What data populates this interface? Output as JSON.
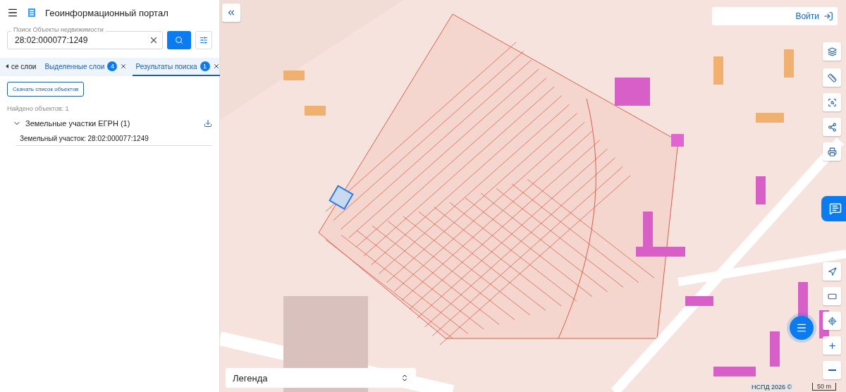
{
  "header": {
    "title": "Геоинформационный портал"
  },
  "search": {
    "label": "Поиск Объекты недвижимости",
    "value": "28:02:000077:1249"
  },
  "tabs": [
    {
      "label": "се слои",
      "selected": false,
      "kind": "back"
    },
    {
      "label": "Выделенные слои",
      "count": "4",
      "selected": false,
      "kind": "closable"
    },
    {
      "label": "Результаты поиска",
      "count": "1",
      "selected": true,
      "kind": "closable"
    }
  ],
  "download_button": "Скачать список объектов",
  "found": "Найдено объектов: 1",
  "groups": [
    {
      "title": "Земельные участки ЕГРН (1)",
      "expanded": true,
      "items": [
        {
          "label": "Земельный участок: 28:02:000077:1249"
        }
      ]
    }
  ],
  "map": {
    "login": "Войти",
    "legend": "Легенда",
    "attribution": "НСПД 2026 ©",
    "scale": "50 m"
  }
}
